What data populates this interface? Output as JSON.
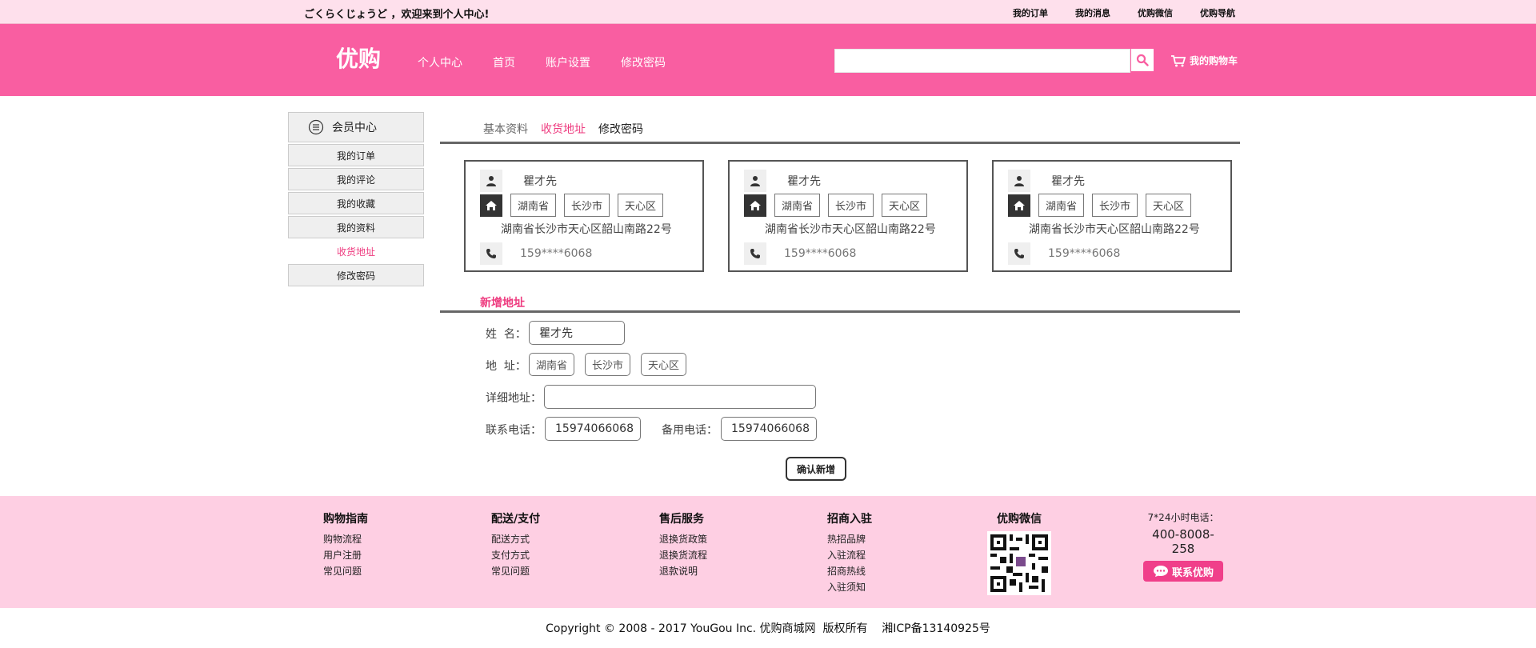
{
  "topbar": {
    "greeting": "ごくらくじょうど ，欢迎来到个人中心!",
    "links": [
      "我的订单",
      "我的消息",
      "优购微信",
      "优购导航"
    ]
  },
  "header": {
    "logo": "优购",
    "nav": [
      "个人中心",
      "首页",
      "账户设置",
      "修改密码"
    ],
    "cart_label": "我的购物车"
  },
  "sidebar": {
    "title": "会员中心",
    "items": [
      "我的订单",
      "我的评论",
      "我的收藏",
      "我的资料",
      "收货地址",
      "修改密码"
    ],
    "active_index": 4
  },
  "tabs": [
    "基本资料",
    "收货地址",
    "修改密码"
  ],
  "addresses": [
    {
      "name": "瞿才先",
      "province": "湖南省",
      "city": "长沙市",
      "district": "天心区",
      "full": "湖南省长沙市天心区韶山南路22号",
      "phone": "159****6068"
    },
    {
      "name": "瞿才先",
      "province": "湖南省",
      "city": "长沙市",
      "district": "天心区",
      "full": "湖南省长沙市天心区韶山南路22号",
      "phone": "159****6068"
    },
    {
      "name": "瞿才先",
      "province": "湖南省",
      "city": "长沙市",
      "district": "天心区",
      "full": "湖南省长沙市天心区韶山南路22号",
      "phone": "159****6068"
    }
  ],
  "form": {
    "title": "新增地址",
    "name_label": "姓  名：",
    "name_value": "瞿才先",
    "addr_label": "地  址：",
    "province": "湖南省",
    "city": "长沙市",
    "district": "天心区",
    "detail_label": "详细地址：",
    "detail_value": "",
    "phone_label": "联系电话：",
    "phone_value": "15974066068",
    "alt_phone_label": "备用电话：",
    "alt_phone_value": "15974066068",
    "confirm": "确认新增"
  },
  "footer": {
    "columns": [
      {
        "title": "购物指南",
        "links": [
          "购物流程",
          "用户注册",
          "常见问题"
        ]
      },
      {
        "title": "配送/支付",
        "links": [
          "配送方式",
          "支付方式",
          "常见问题"
        ]
      },
      {
        "title": "售后服务",
        "links": [
          "退换货政策",
          "退换货流程",
          "退款说明"
        ]
      },
      {
        "title": "招商入驻",
        "links": [
          "热招品牌",
          "入驻流程",
          "招商热线",
          "入驻须知"
        ]
      }
    ],
    "wechat_title": "优购微信",
    "hotline_label": "7*24小时电话：",
    "hotline": "400-8008-258",
    "contact_btn": "联系优购",
    "copyright": "Copyright © 2008 - 2017 YouGou Inc. 优购商城网  版权所有    湘ICP备13140925号"
  },
  "colors": {
    "brand": "#f95ea1",
    "accent": "#ee3b7f",
    "footer_bg": "#fecfe3",
    "topbar_bg": "#fee0ec"
  }
}
